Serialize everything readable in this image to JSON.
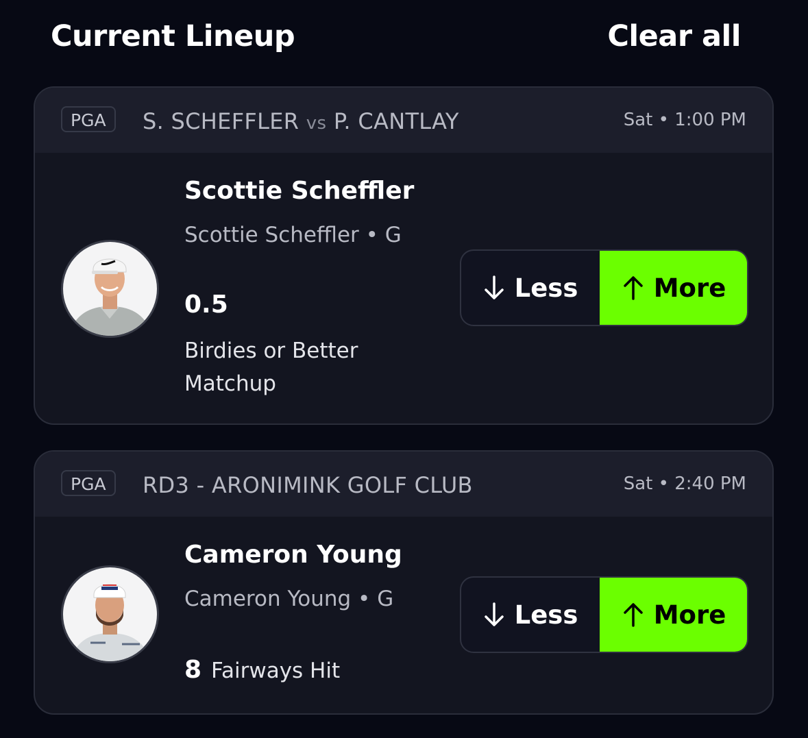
{
  "header": {
    "title": "Current Lineup",
    "clear_label": "Clear all"
  },
  "colors": {
    "more_accent": "#6bff00",
    "background": "#070914",
    "card": "#131520"
  },
  "cards": [
    {
      "league": "PGA",
      "matchup_a": "S. SCHEFFLER",
      "matchup_vs": "vs",
      "matchup_b": "P. CANTLAY",
      "time": "Sat • 1:00 PM",
      "player_name": "Scottie Scheffler",
      "player_sub": "Scottie Scheffler • G",
      "line": "0.5",
      "stat": "Birdies or Better Matchup",
      "less_label": "Less",
      "more_label": "More",
      "selected": "More"
    },
    {
      "league": "PGA",
      "matchup_title": "RD3 - ARONIMINK GOLF CLUB",
      "time": "Sat • 2:40 PM",
      "player_name": "Cameron Young",
      "player_sub": "Cameron Young • G",
      "line": "8",
      "stat": "Fairways Hit",
      "less_label": "Less",
      "more_label": "More",
      "selected": "More"
    }
  ]
}
